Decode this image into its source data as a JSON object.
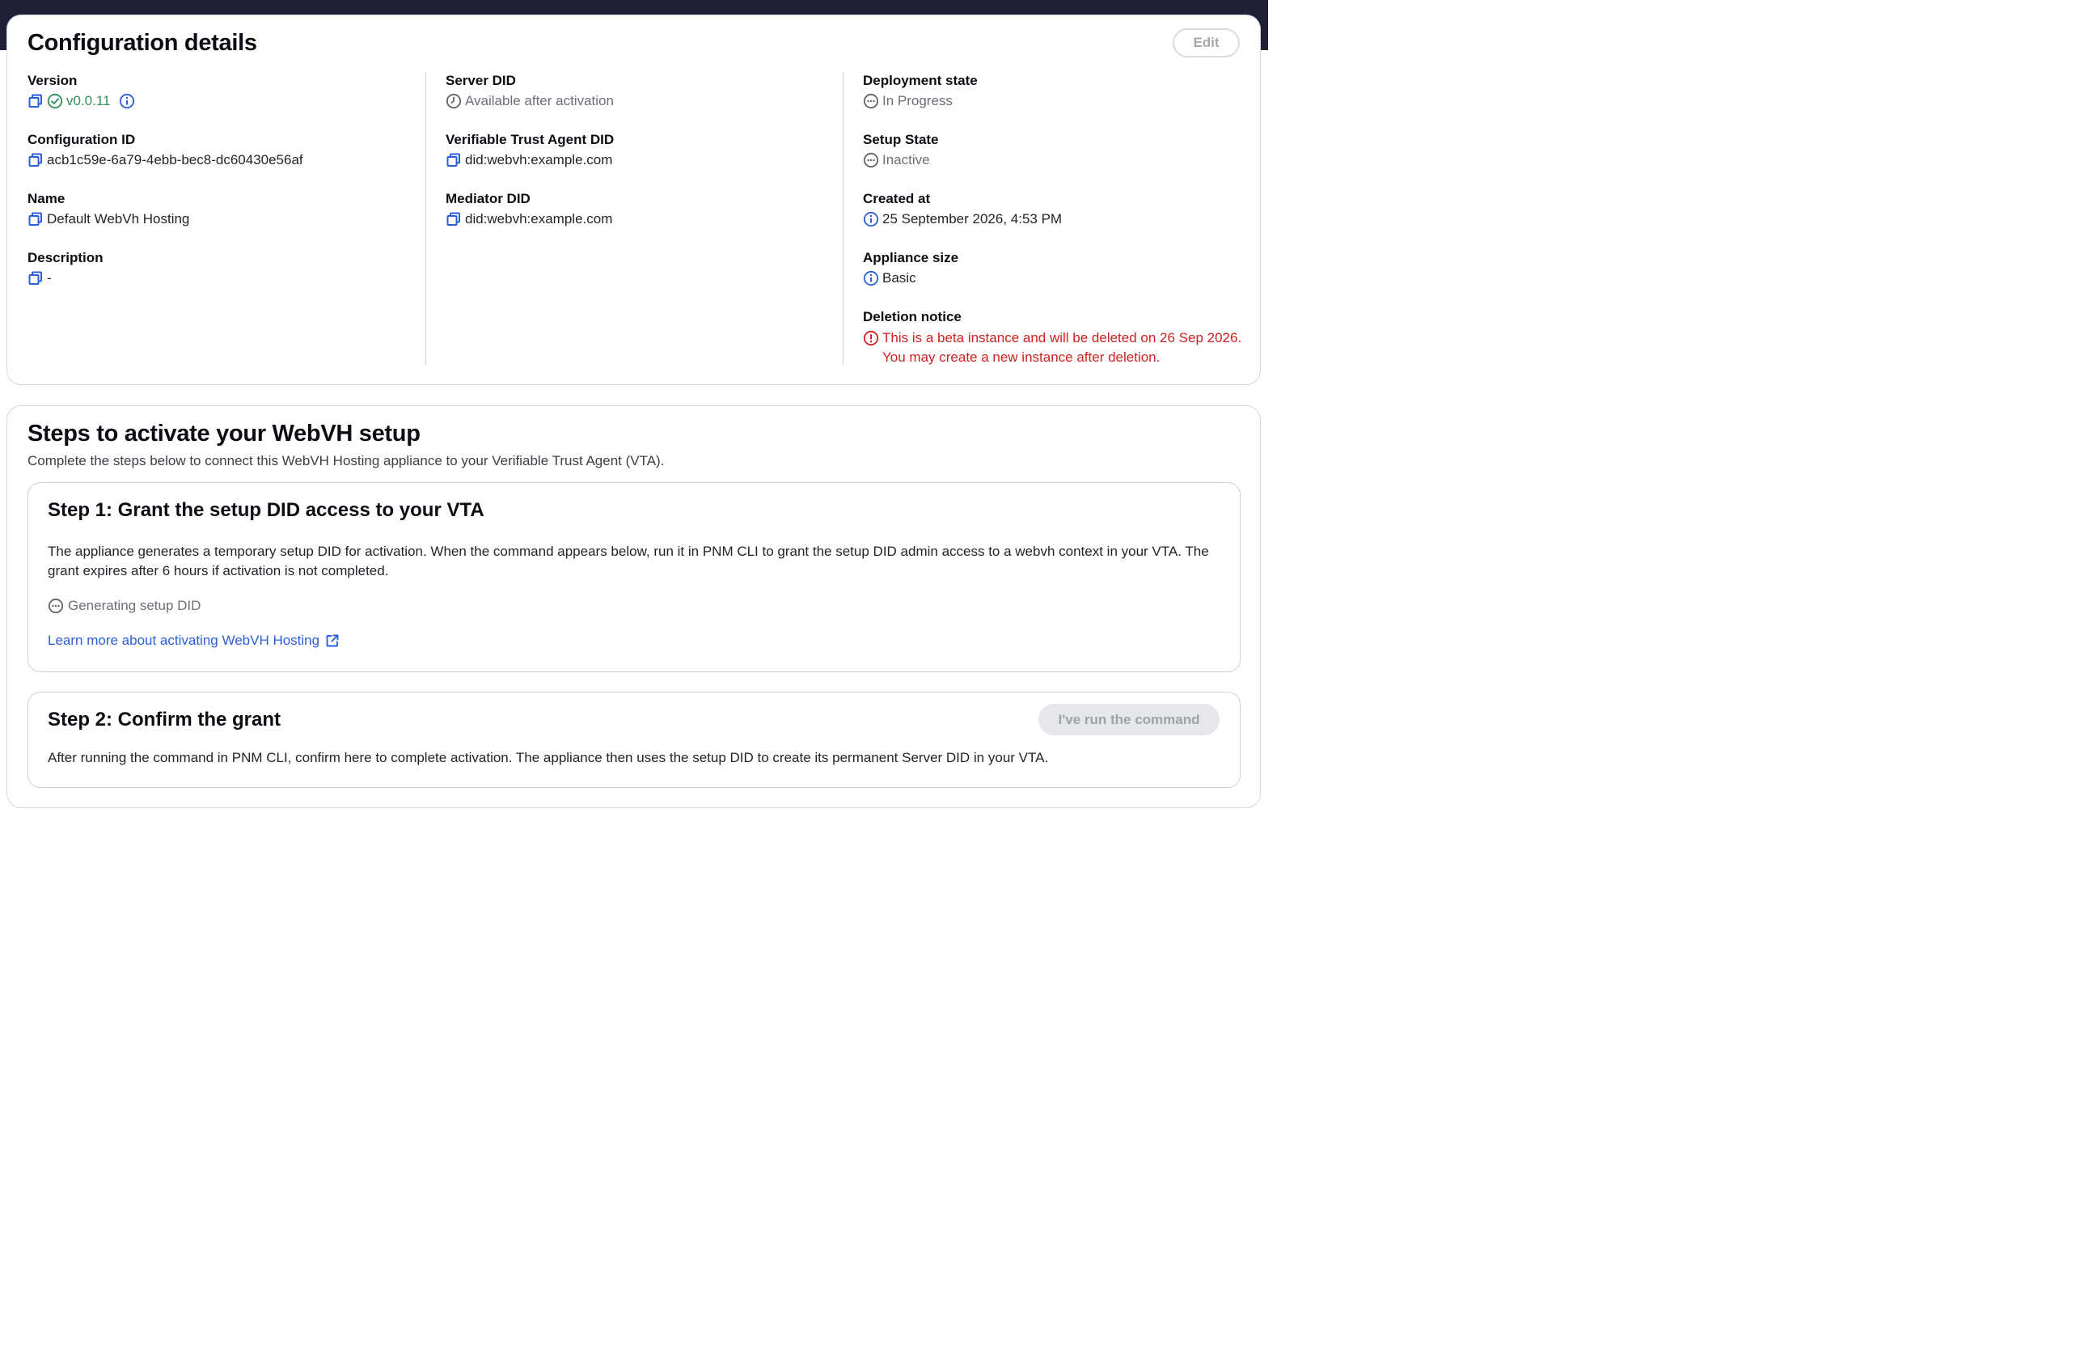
{
  "config": {
    "title": "Configuration details",
    "edit_label": "Edit",
    "columns": [
      [
        {
          "label": "Version",
          "value": "v0.0.11",
          "icon": "copy-icon",
          "status_icon": "check-circle-icon",
          "info_icon": "info-icon"
        },
        {
          "label": "Configuration ID",
          "value": "acb1c59e-6a79-4ebb-bec8-dc60430e56af",
          "icon": "copy-icon"
        },
        {
          "label": "Name",
          "value": "Default WebVh Hosting",
          "icon": "copy-icon"
        },
        {
          "label": "Description",
          "value": "-",
          "icon": "copy-icon"
        }
      ],
      [
        {
          "label": "Server DID",
          "value": "Available after activation",
          "icon": "clock-icon"
        },
        {
          "label": "Verifiable Trust Agent DID",
          "value": "did:webvh:example.com",
          "icon": "copy-icon"
        },
        {
          "label": "Mediator DID",
          "value": "did:webvh:example.com",
          "icon": "copy-icon"
        }
      ],
      [
        {
          "label": "Deployment state",
          "value": "In Progress",
          "icon": "ellipsis-circle-icon"
        },
        {
          "label": "Setup State",
          "value": "Inactive",
          "icon": "ellipsis-circle-icon"
        },
        {
          "label": "Created at",
          "value": "25 September 2026, 4:53 PM",
          "icon": "info-icon"
        },
        {
          "label": "Appliance size",
          "value": "Basic",
          "icon": "info-icon"
        },
        {
          "label": "Deletion notice",
          "value_line1": "This is a beta instance and will be deleted on 26 Sep 2026.",
          "value_line2": "You may create a new instance after deletion.",
          "icon": "alert-circle-icon"
        }
      ]
    ]
  },
  "steps": {
    "title": "Steps to activate your WebVH setup",
    "subtitle": "Complete the steps below to connect this WebVH Hosting appliance to your Verifiable Trust Agent (VTA).",
    "step1": {
      "title": "Step 1: Grant the setup DID access to your VTA",
      "description": "The appliance generates a temporary setup DID for activation. When the command appears below, run it in PNM CLI to grant the setup DID admin access to a webvh context in your VTA. The grant expires after 6 hours if activation is not completed.",
      "status": "Generating setup DID",
      "link": "Learn more about activating WebVH Hosting"
    },
    "step2": {
      "title": "Step 2: Confirm the grant",
      "button": "I've run the command",
      "description": "After running the command in PNM CLI, confirm here to complete activation. The appliance then uses the setup DID to create its permanent Server DID in your VTA."
    }
  },
  "colors": {
    "accent_blue": "#2b5fd9",
    "success_green": "#2f8f5a",
    "error_red": "#d32020",
    "muted_gray": "#6b6f76",
    "topbar": "#1e2136"
  }
}
